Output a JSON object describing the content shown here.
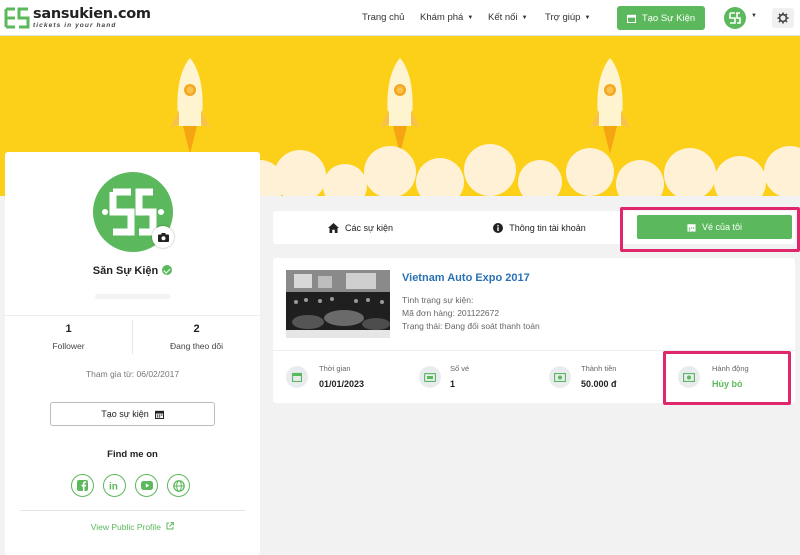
{
  "brand": {
    "name": "sansukien.com",
    "tagline": "tickets in your hand"
  },
  "nav": {
    "menu": [
      {
        "label": "Trang chủ",
        "caret": ""
      },
      {
        "label": "Khám phá",
        "caret": "▼"
      },
      {
        "label": "Kết nối",
        "caret": "▼"
      },
      {
        "label": "Trợ giúp",
        "caret": "▼"
      }
    ],
    "create_event": "Tạo Sự Kiện",
    "avatar_caret": "▼"
  },
  "profile": {
    "name": "Săn Sự Kiện",
    "followers_count": "1",
    "followers_label": "Follower",
    "following_count": "2",
    "following_label": "Đang theo dõi",
    "joined": "Tham gia từ: 06/02/2017",
    "create_event_button": "Tạo sự kiện",
    "find_me": "Find me on",
    "view_public": "View Public Profile"
  },
  "tabs": {
    "events": "Các sự kiện",
    "account": "Thông tin tài khoản",
    "my_tickets": "Vé của tôi"
  },
  "ticket": {
    "title": "Vietnam Auto Expo 2017",
    "status_label": "Tình trạng sự kiện:",
    "order_code": "Mã đơn hàng: 201122672",
    "state": "Trạng thái: Đang đối soát thanh toán",
    "time_label": "Thời gian",
    "time_value": "01/01/2023",
    "qty_label": "Số vé",
    "qty_value": "1",
    "total_label": "Thành tiền",
    "total_value": "50.000 đ",
    "action_label": "Hành động",
    "action_value": "Hủy bỏ"
  },
  "colors": {
    "green": "#5cb85c",
    "banner": "#fcd018",
    "highlight": "#e0266c",
    "link": "#2a72b5"
  }
}
